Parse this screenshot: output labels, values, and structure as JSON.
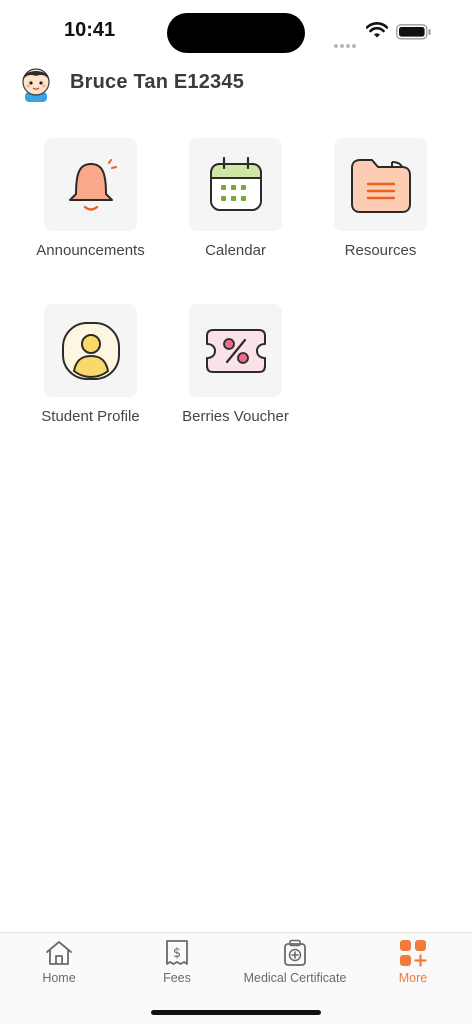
{
  "status_bar": {
    "time": "10:41",
    "signal_icon": "cellular-signal-icon",
    "wifi_icon": "wifi-icon",
    "battery_icon": "battery-icon"
  },
  "header": {
    "avatar_icon": "student-avatar-icon",
    "user_name": "Bruce Tan E12345"
  },
  "tiles": [
    {
      "label": "Announcements",
      "icon": "bell-icon",
      "color": "#F9A98A"
    },
    {
      "label": "Calendar",
      "icon": "calendar-icon",
      "color": "#CFE6A4"
    },
    {
      "label": "Resources",
      "icon": "folder-icon",
      "color": "#FDCDB3"
    },
    {
      "label": "Student Profile",
      "icon": "profile-icon",
      "color": "#FAD86A"
    },
    {
      "label": "Berries Voucher",
      "icon": "voucher-icon",
      "color": "#FBE1E8"
    }
  ],
  "bottom_nav": {
    "items": [
      {
        "label": "Home",
        "icon": "home-icon"
      },
      {
        "label": "Fees",
        "icon": "receipt-dollar-icon"
      },
      {
        "label": "Medical Certificate",
        "icon": "medical-kit-icon"
      },
      {
        "label": "More",
        "icon": "more-grid-icon",
        "active": true
      }
    ],
    "accent_color": "#F07B3A"
  }
}
